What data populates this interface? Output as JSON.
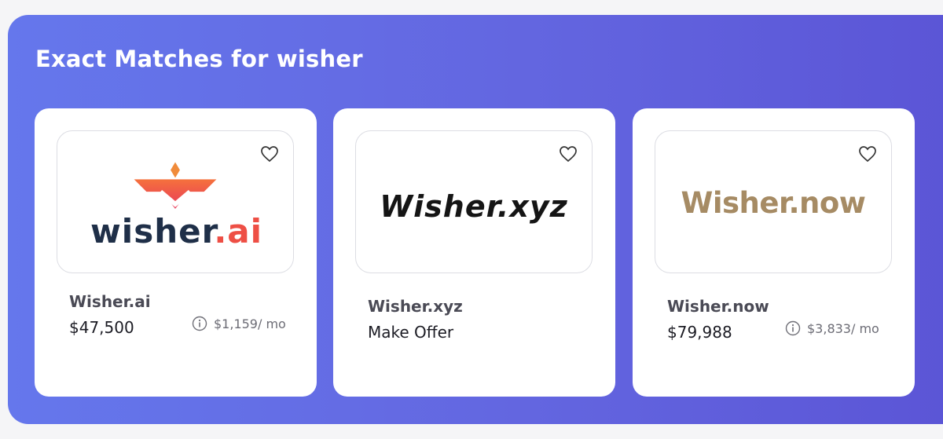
{
  "section": {
    "title": "Exact Matches for wisher"
  },
  "cards": [
    {
      "logo": {
        "main": "wisher",
        "suffix": ".ai"
      },
      "name": "Wisher.ai",
      "price": "$47,500",
      "monthly": "$1,159/ mo"
    },
    {
      "logo": {
        "text": "Wisher.xyz"
      },
      "name": "Wisher.xyz",
      "price": "Make Offer"
    },
    {
      "logo": {
        "text": "Wisher.now"
      },
      "name": "Wisher.now",
      "price": "$79,988",
      "monthly": "$3,833/ mo"
    }
  ],
  "colors": {
    "panel_start": "#6577ec",
    "panel_end": "#5b55d6",
    "logo1_dark": "#1f2f48",
    "logo1_accent": "#ee4f45",
    "logo3_gold": "#a68b64"
  },
  "icons": [
    "heart-icon",
    "info-icon",
    "crown-logo-icon"
  ]
}
